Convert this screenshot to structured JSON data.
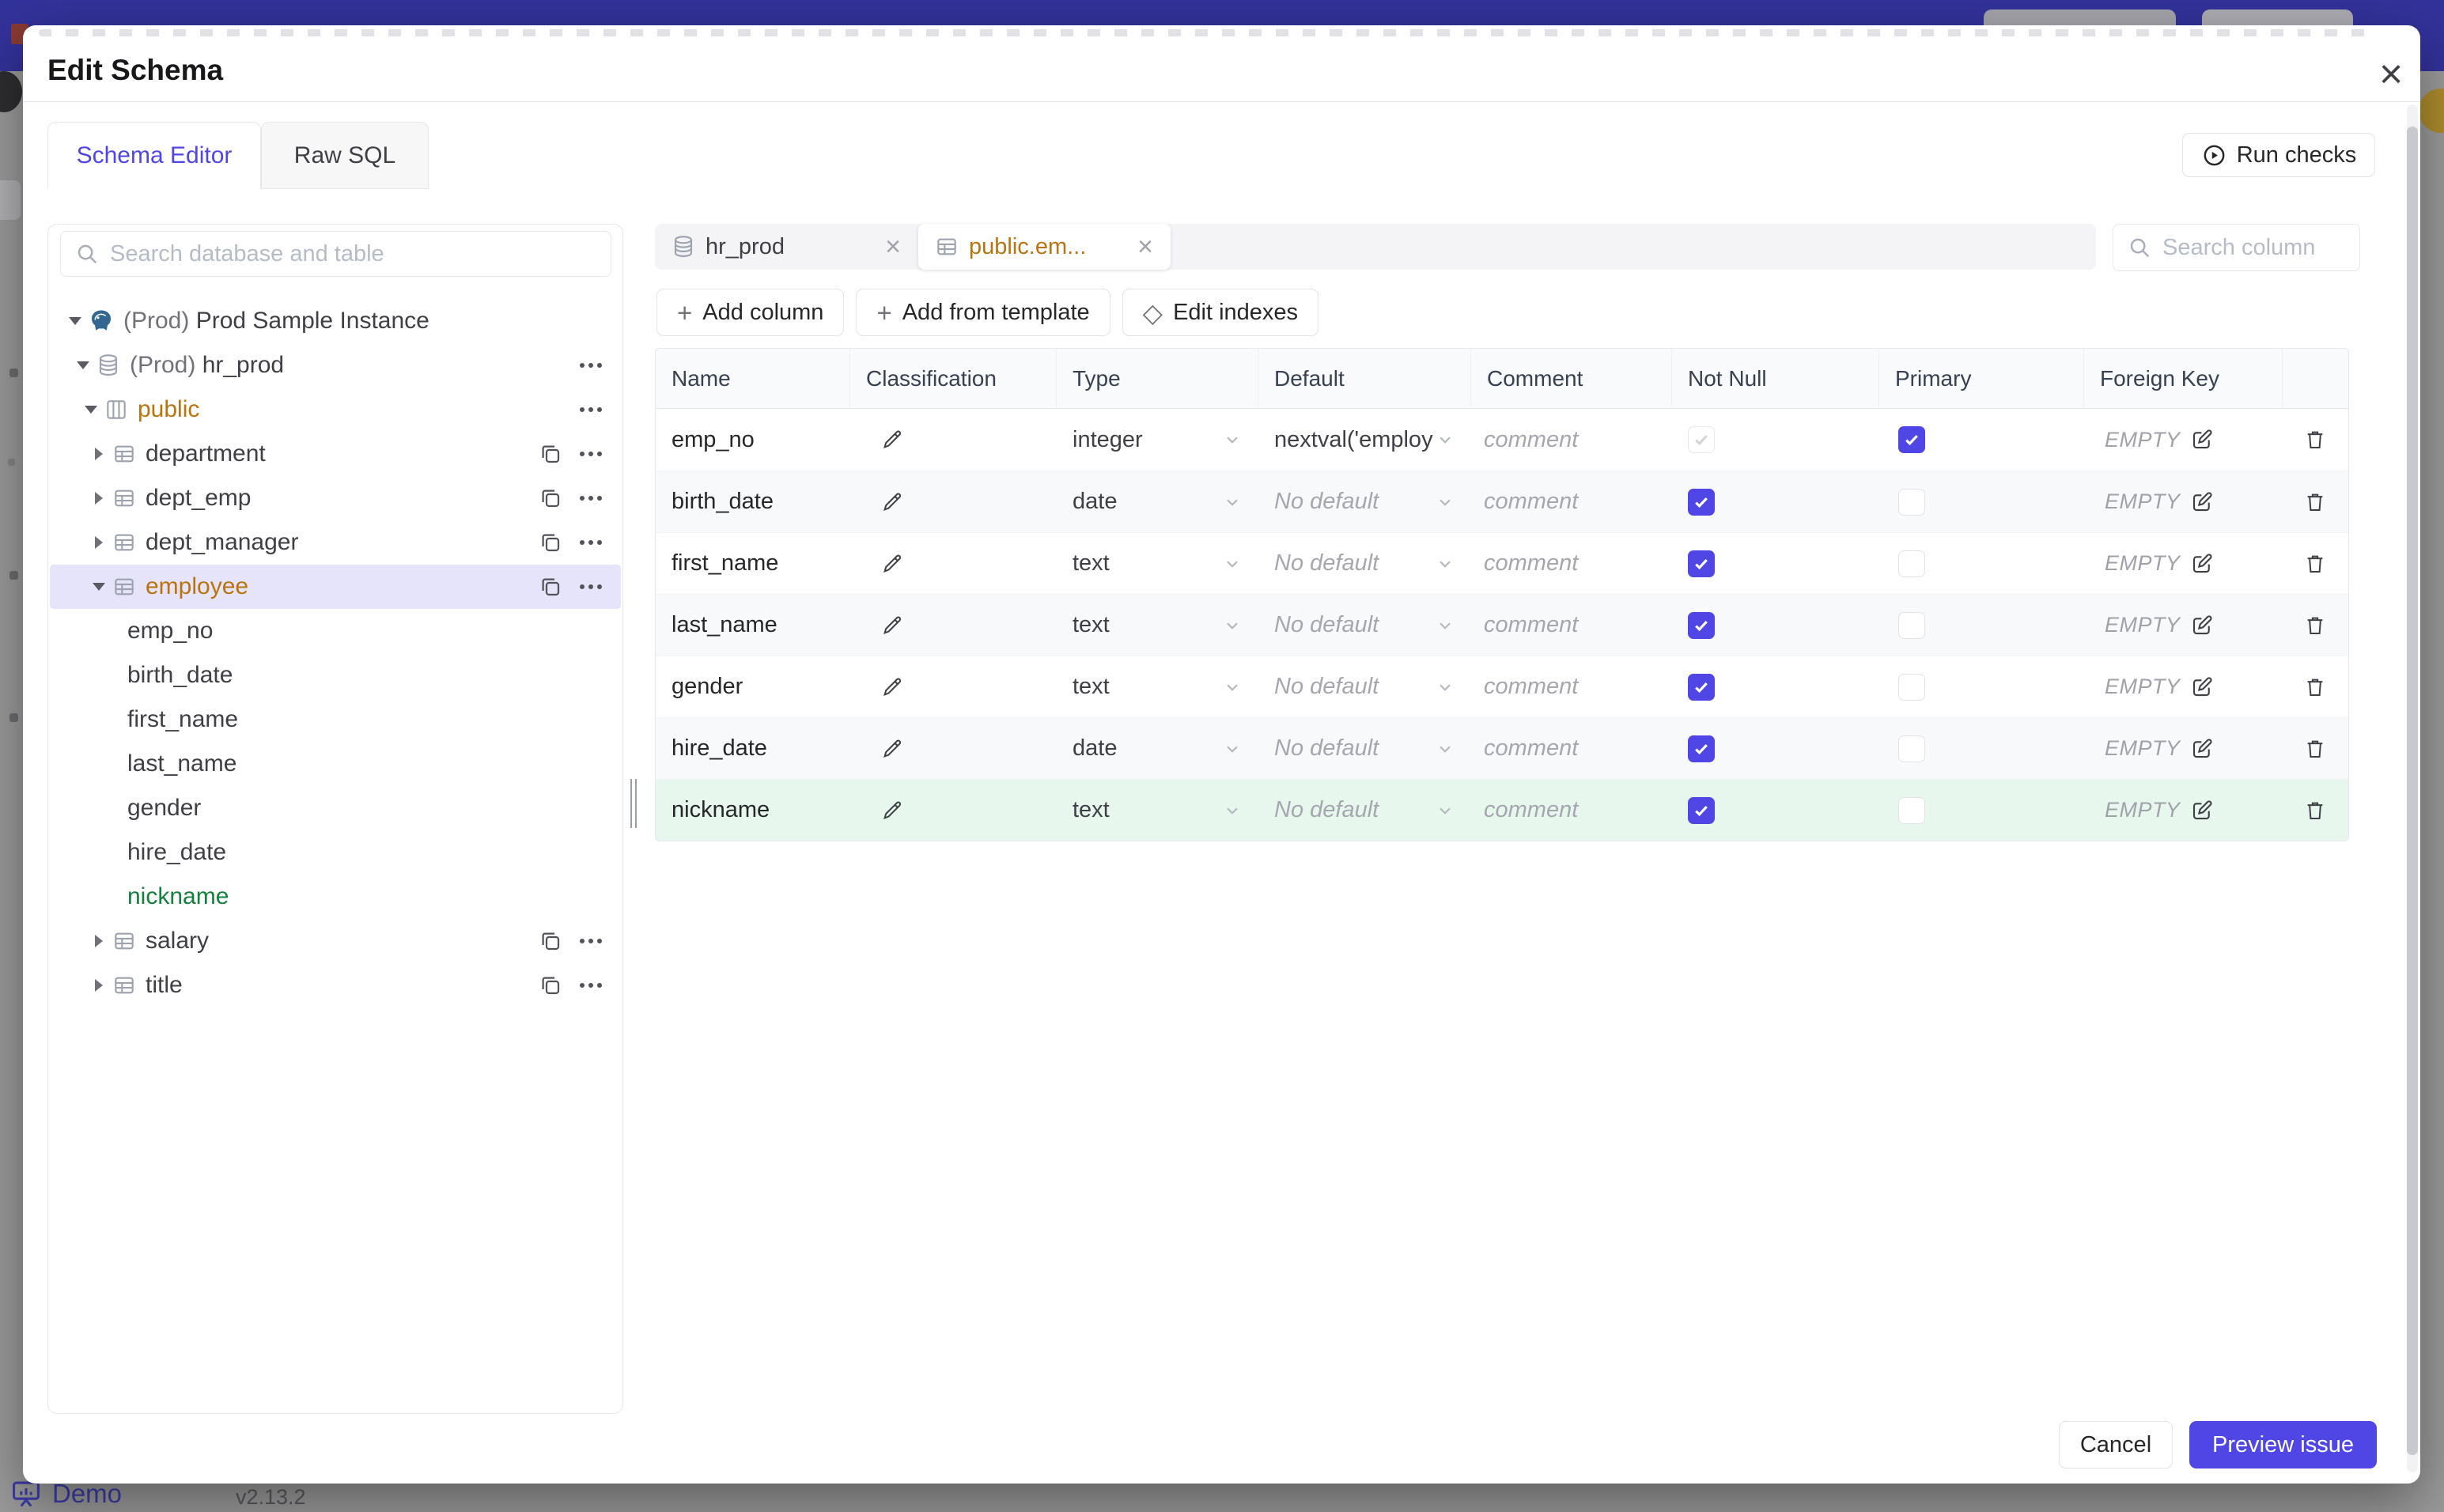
{
  "background": {
    "demo_label": "Demo",
    "version": "v2.13.2"
  },
  "modal": {
    "title": "Edit Schema",
    "close_icon": "×"
  },
  "tabs": [
    {
      "label": "Schema Editor",
      "active": true
    },
    {
      "label": "Raw SQL",
      "active": false
    }
  ],
  "run_checks": {
    "label": "Run checks"
  },
  "sidebar": {
    "search_placeholder": "Search database and table",
    "tree": [
      {
        "label": "Prod Sample Instance",
        "prefix": "(Prod) ",
        "level": 0,
        "icon": "postgres",
        "caret": "down",
        "copy": false,
        "dots": false,
        "color": "default",
        "selected": false
      },
      {
        "label": "hr_prod",
        "prefix": "(Prod) ",
        "level": 1,
        "icon": "database",
        "caret": "down",
        "copy": false,
        "dots": true,
        "color": "default",
        "selected": false
      },
      {
        "label": "public",
        "prefix": "",
        "level": 2,
        "icon": "schema",
        "caret": "down",
        "copy": false,
        "dots": true,
        "color": "amber",
        "selected": false
      },
      {
        "label": "department",
        "prefix": "",
        "level": 3,
        "icon": "table",
        "caret": "right",
        "copy": true,
        "dots": true,
        "color": "default",
        "selected": false
      },
      {
        "label": "dept_emp",
        "prefix": "",
        "level": 3,
        "icon": "table",
        "caret": "right",
        "copy": true,
        "dots": true,
        "color": "default",
        "selected": false
      },
      {
        "label": "dept_manager",
        "prefix": "",
        "level": 3,
        "icon": "table",
        "caret": "right",
        "copy": true,
        "dots": true,
        "color": "default",
        "selected": false
      },
      {
        "label": "employee",
        "prefix": "",
        "level": 3,
        "icon": "table",
        "caret": "down",
        "copy": true,
        "dots": true,
        "color": "amber",
        "selected": true
      },
      {
        "label": "emp_no",
        "prefix": "",
        "level": 4,
        "icon": "none",
        "caret": "none",
        "copy": false,
        "dots": false,
        "color": "default",
        "selected": false
      },
      {
        "label": "birth_date",
        "prefix": "",
        "level": 4,
        "icon": "none",
        "caret": "none",
        "copy": false,
        "dots": false,
        "color": "default",
        "selected": false
      },
      {
        "label": "first_name",
        "prefix": "",
        "level": 4,
        "icon": "none",
        "caret": "none",
        "copy": false,
        "dots": false,
        "color": "default",
        "selected": false
      },
      {
        "label": "last_name",
        "prefix": "",
        "level": 4,
        "icon": "none",
        "caret": "none",
        "copy": false,
        "dots": false,
        "color": "default",
        "selected": false
      },
      {
        "label": "gender",
        "prefix": "",
        "level": 4,
        "icon": "none",
        "caret": "none",
        "copy": false,
        "dots": false,
        "color": "default",
        "selected": false
      },
      {
        "label": "hire_date",
        "prefix": "",
        "level": 4,
        "icon": "none",
        "caret": "none",
        "copy": false,
        "dots": false,
        "color": "default",
        "selected": false
      },
      {
        "label": "nickname",
        "prefix": "",
        "level": 4,
        "icon": "none",
        "caret": "none",
        "copy": false,
        "dots": false,
        "color": "green",
        "selected": false
      },
      {
        "label": "salary",
        "prefix": "",
        "level": 3,
        "icon": "table",
        "caret": "right",
        "copy": true,
        "dots": true,
        "color": "default",
        "selected": false
      },
      {
        "label": "title",
        "prefix": "",
        "level": 3,
        "icon": "table",
        "caret": "right",
        "copy": true,
        "dots": true,
        "color": "default",
        "selected": false
      }
    ]
  },
  "editor": {
    "chips": [
      {
        "label": "hr_prod",
        "icon": "database",
        "active": false,
        "close_icon": "×"
      },
      {
        "label": "public.em...",
        "icon": "table",
        "active": true,
        "close_icon": "×"
      }
    ],
    "column_search_placeholder": "Search column",
    "actions": [
      {
        "label": "Add column",
        "icon_char": "+"
      },
      {
        "label": "Add from template",
        "icon_char": "+"
      },
      {
        "label": "Edit indexes",
        "icon_char": "◇"
      }
    ],
    "table": {
      "headers": [
        "Name",
        "Classification",
        "Type",
        "Default",
        "Comment",
        "Not Null",
        "Primary",
        "Foreign Key",
        ""
      ],
      "comment_placeholder": "comment",
      "fk_value": "EMPTY",
      "rows": [
        {
          "name": "emp_no",
          "type": "integer",
          "default": "nextval('employ",
          "default_placeholder": false,
          "not_null": true,
          "not_null_disabled": true,
          "primary": true,
          "bg": "white"
        },
        {
          "name": "birth_date",
          "type": "date",
          "default": "No default",
          "default_placeholder": true,
          "not_null": true,
          "not_null_disabled": false,
          "primary": false,
          "bg": "gray"
        },
        {
          "name": "first_name",
          "type": "text",
          "default": "No default",
          "default_placeholder": true,
          "not_null": true,
          "not_null_disabled": false,
          "primary": false,
          "bg": "white"
        },
        {
          "name": "last_name",
          "type": "text",
          "default": "No default",
          "default_placeholder": true,
          "not_null": true,
          "not_null_disabled": false,
          "primary": false,
          "bg": "gray"
        },
        {
          "name": "gender",
          "type": "text",
          "default": "No default",
          "default_placeholder": true,
          "not_null": true,
          "not_null_disabled": false,
          "primary": false,
          "bg": "white"
        },
        {
          "name": "hire_date",
          "type": "date",
          "default": "No default",
          "default_placeholder": true,
          "not_null": true,
          "not_null_disabled": false,
          "primary": false,
          "bg": "gray"
        },
        {
          "name": "nickname",
          "type": "text",
          "default": "No default",
          "default_placeholder": true,
          "not_null": true,
          "not_null_disabled": false,
          "primary": false,
          "bg": "green"
        }
      ]
    }
  },
  "footer": {
    "cancel_label": "Cancel",
    "preview_label": "Preview issue"
  },
  "colors": {
    "accent": "#4f46e5",
    "amber": "#b9730f",
    "green": "#15803d",
    "selected_tree_bg": "#e6e4fb",
    "added_row_bg": "#e8f7ee"
  }
}
